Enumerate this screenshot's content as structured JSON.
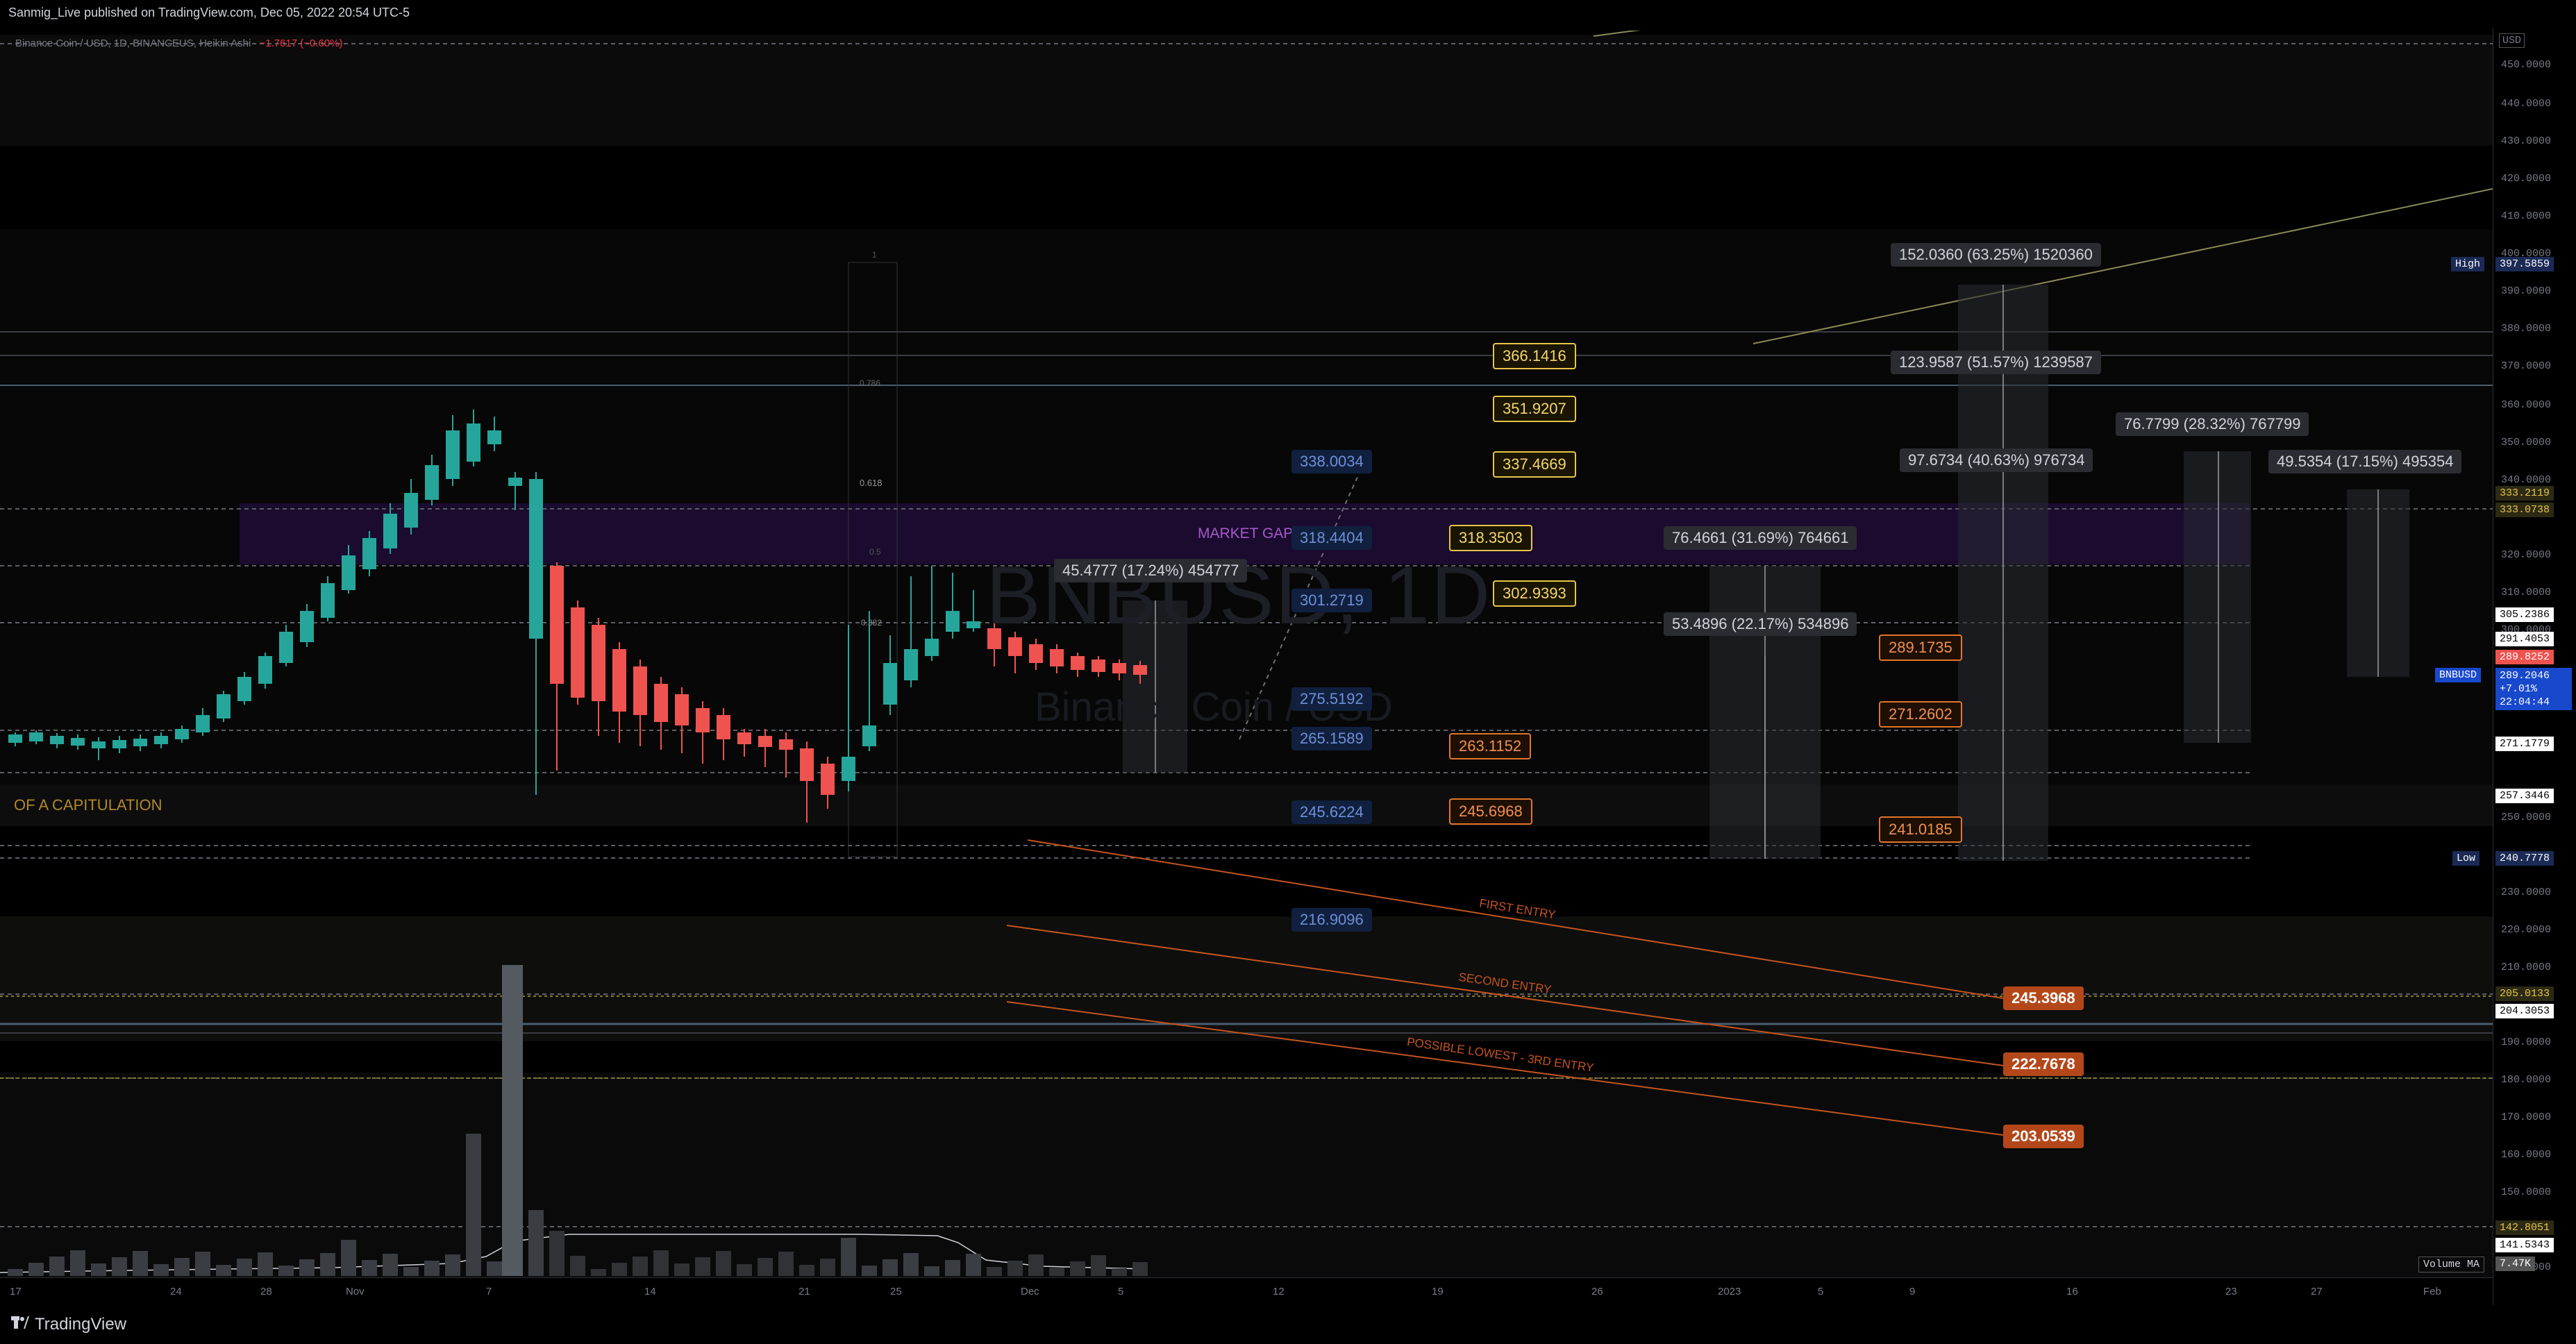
{
  "header": {
    "published": "Sanmig_Live published on TradingView.com, Dec 05, 2022 20:54 UTC-5",
    "symbol_line": "Binance Coin / USD, 1D, BINANCEUS, Heikin Ashi",
    "change": "−1.7617 (−0.60%)"
  },
  "watermark": {
    "ticker": "BNBUSD, 1D",
    "name": "Binance Coin / USD"
  },
  "price_axis": {
    "currency": "USD",
    "ticks": [
      "450.0000",
      "440.0000",
      "430.0000",
      "420.0000",
      "410.0000",
      "400.0000",
      "390.0000",
      "380.0000",
      "370.0000",
      "360.0000",
      "350.0000",
      "340.0000",
      "320.0000",
      "310.0000",
      "300.0000",
      "280.0000",
      "250.0000",
      "230.0000",
      "220.0000",
      "210.0000",
      "190.0000",
      "180.0000",
      "170.0000",
      "160.0000",
      "150.0000",
      "130.0000"
    ],
    "badges": {
      "high_label": "High",
      "high_value": "397.5859",
      "low_label": "Low",
      "low_value": "240.7778",
      "p333a": "333.2119",
      "p333b": "333.0738",
      "p305": "305.2386",
      "p291": "291.4053",
      "p289": "289.8252",
      "symbol": "BNBUSD",
      "last": "289.2046",
      "last_chg": "+7.01%",
      "countdown": "22:04:44",
      "p271": "271.1779",
      "p257": "257.3446",
      "p205": "205.0133",
      "p204": "204.3053",
      "p142": "142.8051",
      "p141": "141.5343",
      "volma_label": "Volume MA",
      "volma_value": "7.47K"
    }
  },
  "time_axis": [
    "17",
    "24",
    "28",
    "Nov",
    "7",
    "14",
    "21",
    "25",
    "Dec",
    "5",
    "12",
    "19",
    "26",
    "2023",
    "5",
    "9",
    "16",
    "23",
    "27",
    "Feb"
  ],
  "annotations": {
    "market_gap": "MARKET GAP",
    "capitulation": "OF A  CAPITULATION",
    "first_entry": "FIRST ENTRY",
    "second_entry": "SECOND ENTRY",
    "third_entry": "POSSIBLE LOWEST - 3RD ENTRY",
    "fib": [
      "1",
      "0.786",
      "0.618",
      "0.5",
      "0.382"
    ]
  },
  "targets_yellow": [
    "366.1416",
    "351.9207",
    "337.4669",
    "318.3503",
    "302.9393"
  ],
  "targets_blue": [
    "338.0034",
    "318.4404",
    "301.2719",
    "275.5192",
    "265.1589",
    "245.6224",
    "216.9096"
  ],
  "targets_orange": [
    "289.1735",
    "271.2602",
    "263.1152",
    "245.6968",
    "241.0185"
  ],
  "entries": [
    "245.3968",
    "222.7678",
    "203.0539"
  ],
  "measures": {
    "m1": "45.4777 (17.24%) 454777",
    "m2": "76.4661 (31.69%) 764661",
    "m3": "53.4896 (22.17%) 534896",
    "m4": "152.0360 (63.25%) 1520360",
    "m5": "123.9587 (51.57%) 1239587",
    "m6": "97.6734 (40.63%) 976734",
    "m7": "76.7799 (28.32%) 767799",
    "m8": "49.5354 (17.15%) 495354"
  },
  "colors": {
    "bull": "#26a69a",
    "bear": "#ef5350",
    "yellow": "#e8c54a",
    "orange": "#e0762a",
    "blue": "#2b3f7a",
    "gap": "#2a0f4a"
  },
  "footer": {
    "brand": "TradingView"
  }
}
